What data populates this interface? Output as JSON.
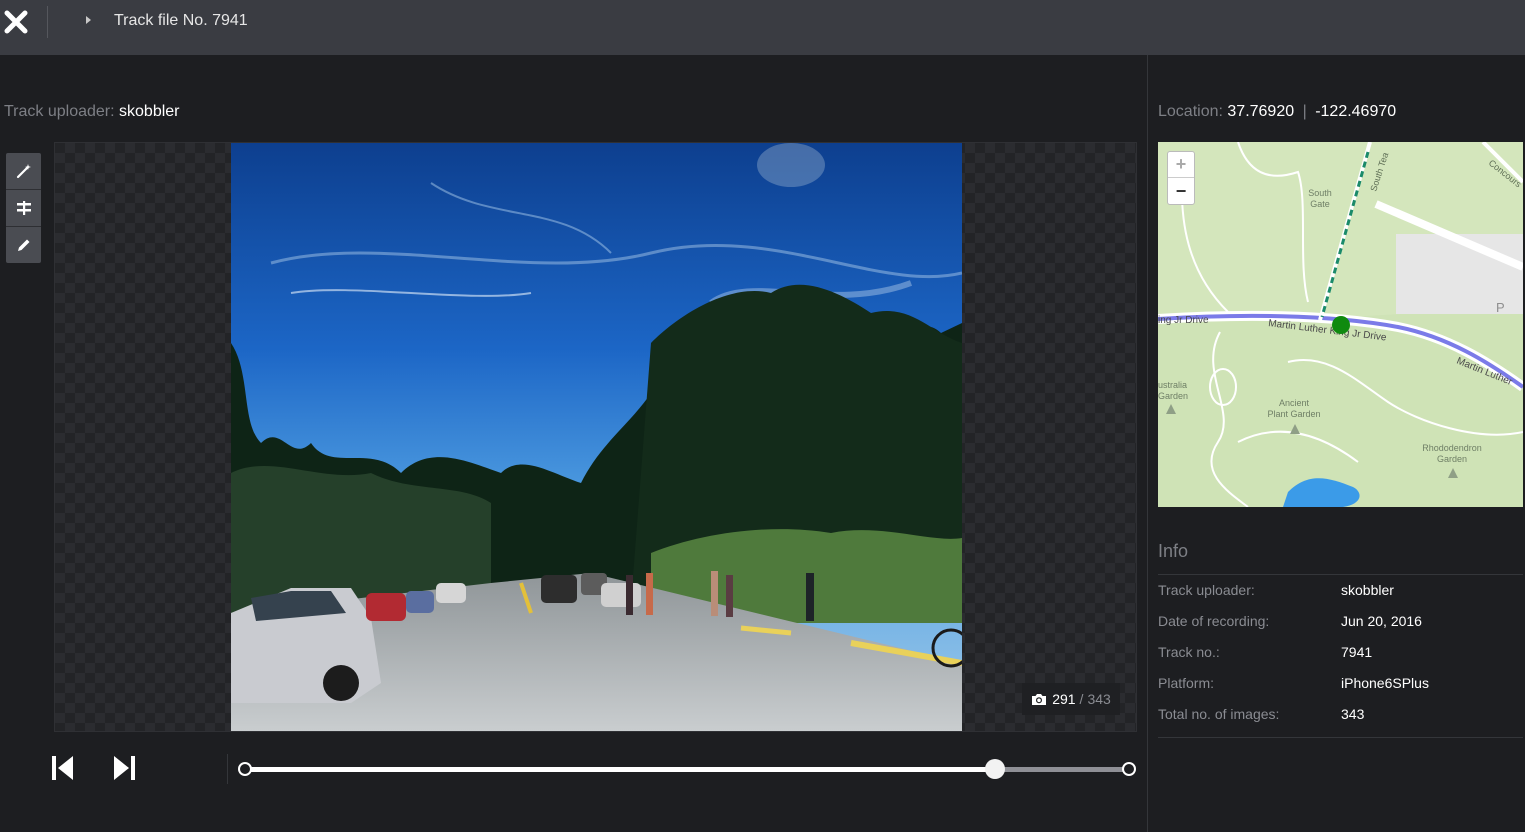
{
  "header": {
    "title": "Track file No. 7941"
  },
  "uploader": {
    "label": "Track uploader:",
    "name": "skobbler"
  },
  "location": {
    "label": "Location:",
    "lat": "37.76920",
    "sep": "|",
    "lng": "-122.46970"
  },
  "viewer": {
    "current_image": "291",
    "separator": "/",
    "total_images": "343",
    "progress_fraction": 0.848
  },
  "map": {
    "zoom_in": "+",
    "zoom_out": "−",
    "labels": {
      "south_gate": "South\nGate",
      "south_tea": "South Tea",
      "concourse": "Concours",
      "drive_left": "ing Jr Drive",
      "mlk_mid": "Martin Luther King Jr Drive",
      "mlk_right": "Martin Luther",
      "australia": "ustralia\nGarden",
      "ancient": "Ancient\nPlant Garden",
      "rhododendron": "Rhododendron\nGarden",
      "parking": "P"
    }
  },
  "info": {
    "heading": "Info",
    "rows": [
      {
        "key": "Track uploader:",
        "value": "skobbler"
      },
      {
        "key": "Date of recording:",
        "value": "Jun 20, 2016"
      },
      {
        "key": "Track no.:",
        "value": "7941"
      },
      {
        "key": "Platform:",
        "value": "iPhone6SPlus"
      },
      {
        "key": "Total no. of images:",
        "value": "343"
      }
    ]
  },
  "colors": {
    "topbar": "#3a3c42",
    "background": "#1d1e21",
    "track_line": "#7b7be8",
    "position_marker": "#0f8a0f",
    "map_land": "#e9efdc",
    "map_park": "#cfe3b6",
    "water": "#3b9be8"
  },
  "icons": [
    "close-icon",
    "caret-right-icon",
    "magic-wand-icon",
    "align-icon",
    "pencil-icon",
    "camera-icon",
    "skip-back-icon",
    "skip-forward-icon"
  ]
}
